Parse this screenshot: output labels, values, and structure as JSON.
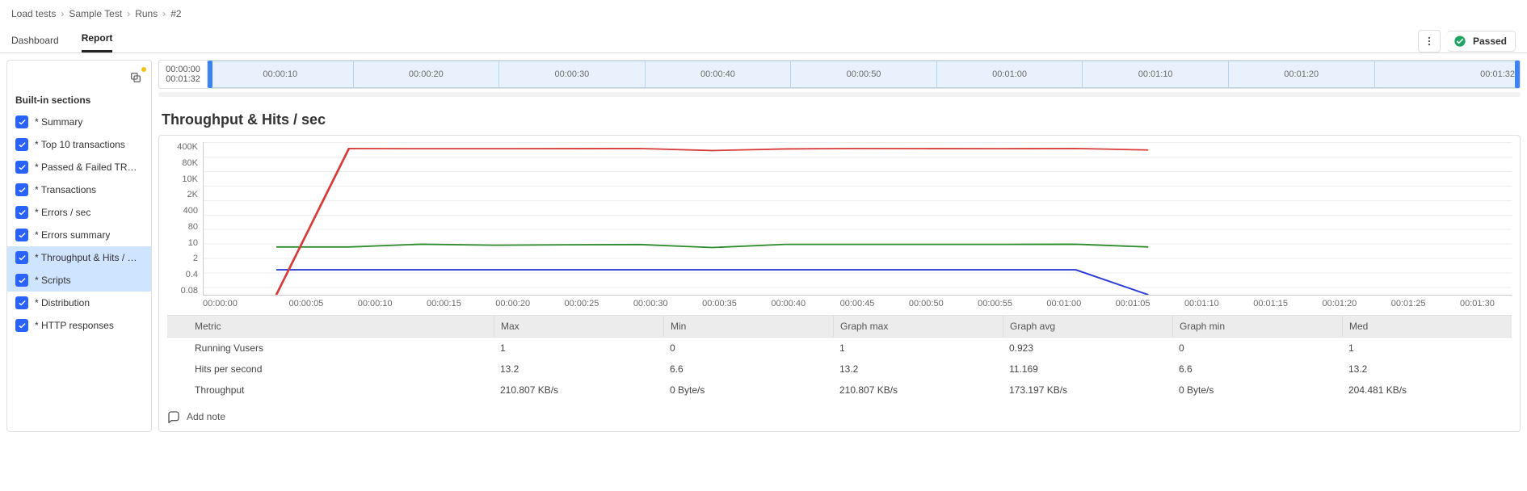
{
  "breadcrumb": {
    "items": [
      "Load tests",
      "Sample Test",
      "Runs",
      "#2"
    ]
  },
  "tabs": {
    "items": [
      {
        "label": "Dashboard",
        "active": false
      },
      {
        "label": "Report",
        "active": true
      }
    ]
  },
  "status": {
    "label": "Passed",
    "color": "#1fa463"
  },
  "sidebar": {
    "title": "Built-in sections",
    "items": [
      {
        "label": "* Summary",
        "checked": true,
        "selected": false
      },
      {
        "label": "* Top 10 transactions",
        "checked": true,
        "selected": false
      },
      {
        "label": "* Passed & Failed TR…",
        "checked": true,
        "selected": false
      },
      {
        "label": "* Transactions",
        "checked": true,
        "selected": false
      },
      {
        "label": "* Errors / sec",
        "checked": true,
        "selected": false
      },
      {
        "label": "* Errors summary",
        "checked": true,
        "selected": false
      },
      {
        "label": "* Throughput & Hits / …",
        "checked": true,
        "selected": true
      },
      {
        "label": "* Scripts",
        "checked": true,
        "selected": true
      },
      {
        "label": "* Distribution",
        "checked": true,
        "selected": false
      },
      {
        "label": "* HTTP responses",
        "checked": true,
        "selected": false
      }
    ]
  },
  "timeline": {
    "range_start": "00:00:00",
    "range_end": "00:01:32",
    "ticks": [
      "00:00:10",
      "00:00:20",
      "00:00:30",
      "00:00:40",
      "00:00:50",
      "00:01:00",
      "00:01:10",
      "00:01:20"
    ],
    "end_label": "00:01:32"
  },
  "chart": {
    "title": "Throughput & Hits / sec"
  },
  "chart_data": {
    "type": "line",
    "x": [
      "00:00:00",
      "00:00:05",
      "00:00:10",
      "00:00:15",
      "00:00:20",
      "00:00:25",
      "00:00:30",
      "00:00:35",
      "00:00:40",
      "00:00:45",
      "00:00:50",
      "00:00:55",
      "00:01:00",
      "00:01:05",
      "00:01:10",
      "00:01:15",
      "00:01:20",
      "00:01:25",
      "00:01:30"
    ],
    "y_ticks": [
      "400K",
      "80K",
      "10K",
      "2K",
      "400",
      "80",
      "10",
      "2",
      "0.4",
      "0.08"
    ],
    "yscale": "log",
    "ylim_data": [
      0.08,
      400000
    ],
    "series": [
      {
        "name": "Running Vusers",
        "color": "#2a3bd8",
        "points": [
          {
            "x": "00:00:05",
            "y": 1
          },
          {
            "x": "00:00:10",
            "y": 1
          },
          {
            "x": "00:00:15",
            "y": 1
          },
          {
            "x": "00:00:20",
            "y": 1
          },
          {
            "x": "00:00:25",
            "y": 1
          },
          {
            "x": "00:00:30",
            "y": 1
          },
          {
            "x": "00:00:35",
            "y": 1
          },
          {
            "x": "00:00:40",
            "y": 1
          },
          {
            "x": "00:00:45",
            "y": 1
          },
          {
            "x": "00:00:50",
            "y": 1
          },
          {
            "x": "00:00:55",
            "y": 1
          },
          {
            "x": "00:01:00",
            "y": 1
          },
          {
            "x": "00:01:05",
            "y": 0.08
          }
        ]
      },
      {
        "name": "Hits per second",
        "color": "#2e8b2e",
        "points": [
          {
            "x": "00:00:05",
            "y": 10
          },
          {
            "x": "00:00:10",
            "y": 10
          },
          {
            "x": "00:00:15",
            "y": 13.2
          },
          {
            "x": "00:00:20",
            "y": 12.0
          },
          {
            "x": "00:00:25",
            "y": 12.5
          },
          {
            "x": "00:00:30",
            "y": 12.8
          },
          {
            "x": "00:00:35",
            "y": 9.5
          },
          {
            "x": "00:00:40",
            "y": 13.0
          },
          {
            "x": "00:00:45",
            "y": 13.0
          },
          {
            "x": "00:00:50",
            "y": 13.0
          },
          {
            "x": "00:00:55",
            "y": 13.0
          },
          {
            "x": "00:01:00",
            "y": 13.2
          },
          {
            "x": "00:01:05",
            "y": 10
          }
        ]
      },
      {
        "name": "Throughput",
        "color": "#d93a3a",
        "points": [
          {
            "x": "00:00:05",
            "y": 0.08
          },
          {
            "x": "00:00:10",
            "y": 210000
          },
          {
            "x": "00:00:15",
            "y": 205000
          },
          {
            "x": "00:00:20",
            "y": 206000
          },
          {
            "x": "00:00:25",
            "y": 208000
          },
          {
            "x": "00:00:30",
            "y": 210000
          },
          {
            "x": "00:00:35",
            "y": 170000
          },
          {
            "x": "00:00:40",
            "y": 200000
          },
          {
            "x": "00:00:45",
            "y": 210000
          },
          {
            "x": "00:00:50",
            "y": 208000
          },
          {
            "x": "00:00:55",
            "y": 206000
          },
          {
            "x": "00:01:00",
            "y": 210000
          },
          {
            "x": "00:01:05",
            "y": 180000
          }
        ]
      }
    ],
    "metrics_table": {
      "columns": [
        "Metric",
        "Max",
        "Min",
        "Graph max",
        "Graph avg",
        "Graph min",
        "Med"
      ],
      "rows": [
        {
          "color": "#2a3bd8",
          "name": "Running Vusers",
          "max": "1",
          "min": "0",
          "gmax": "1",
          "gavg": "0.923",
          "gmin": "0",
          "med": "1"
        },
        {
          "color": "#2e8b2e",
          "name": "Hits per second",
          "max": "13.2",
          "min": "6.6",
          "gmax": "13.2",
          "gavg": "11.169",
          "gmin": "6.6",
          "med": "13.2"
        },
        {
          "color": "#d93a3a",
          "name": "Throughput",
          "max": "210.807 KB/s",
          "min": "0 Byte/s",
          "gmax": "210.807 KB/s",
          "gavg": "173.197 KB/s",
          "gmin": "0 Byte/s",
          "med": "204.481 KB/s"
        }
      ]
    }
  },
  "add_note": {
    "label": "Add note"
  }
}
